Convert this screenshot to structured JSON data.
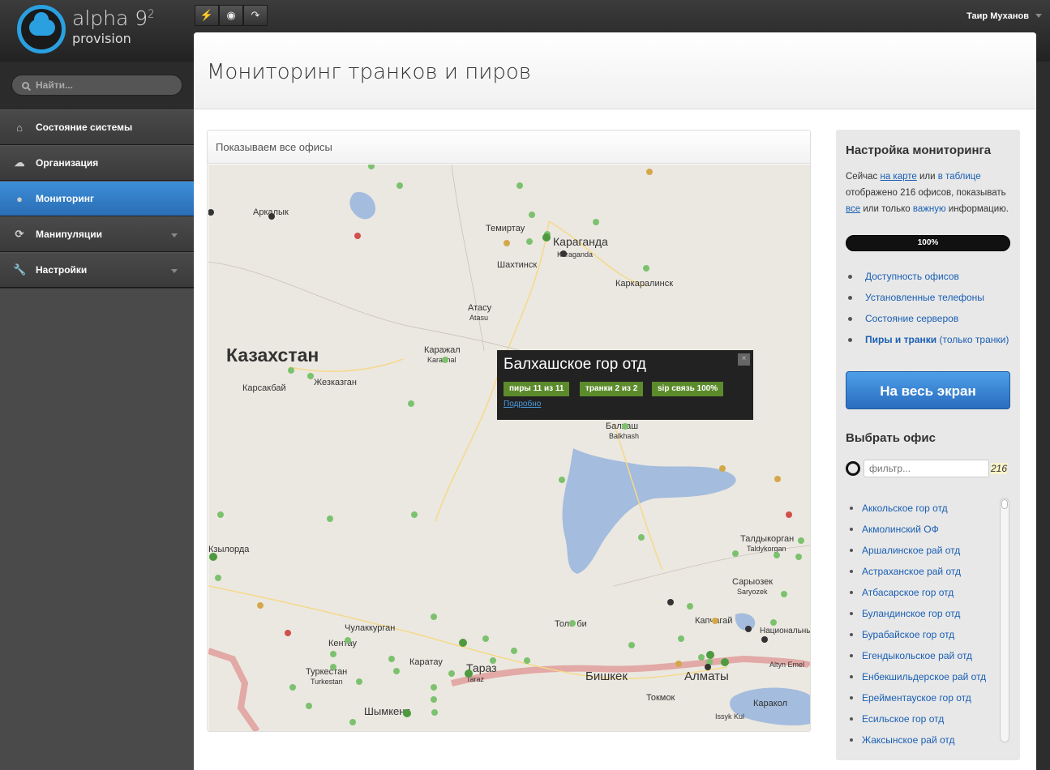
{
  "app": {
    "brand": "alpha 9",
    "brand_sup": "2",
    "brand_sub": "provision"
  },
  "toolbar": {
    "buttons": [
      {
        "icon": "lightning-icon",
        "glyph": "⚡"
      },
      {
        "icon": "eye-icon",
        "glyph": "◉"
      },
      {
        "icon": "redo-icon",
        "glyph": "↷"
      }
    ]
  },
  "user": {
    "name": "Таир Муханов"
  },
  "search": {
    "placeholder": "Найти..."
  },
  "nav": {
    "items": [
      {
        "label": "Состояние системы",
        "icon": "home-icon",
        "glyph": "⌂",
        "active": false
      },
      {
        "label": "Организация",
        "icon": "cloud-icon",
        "glyph": "☁",
        "active": false
      },
      {
        "label": "Мониторинг",
        "icon": "map-pin-icon",
        "glyph": "●",
        "active": true
      },
      {
        "label": "Манипуляции",
        "icon": "refresh-icon",
        "glyph": "⟳",
        "active": false
      },
      {
        "label": "Настройки",
        "icon": "wrench-icon",
        "glyph": "🔧",
        "active": false
      }
    ]
  },
  "page": {
    "title": "Мониторинг транков и пиров"
  },
  "map_panel": {
    "header": "Показываем все офисы"
  },
  "map": {
    "country_label": "Казахстан",
    "places": [
      "Аркалык",
      "Темиртау",
      "Караганда",
      "Karaganda",
      "Шахтинск",
      "Каркаралинск",
      "Атасу",
      "Atasu",
      "Каражал",
      "Karazhal",
      "Жезказган",
      "Карсакбай",
      "Балхаш",
      "Balkhash",
      "Кзылорда",
      "Талдыкорган",
      "Taldykorgan",
      "Сарыозек",
      "Saryozek",
      "Капчагай",
      "Национальный парк Алтын-Эмель",
      "Altyn Emel",
      "Чулаккурган",
      "Кентау",
      "Туркестан",
      "Turkestan",
      "Каратау",
      "Тараз",
      "Taraz",
      "Толе би",
      "Бишкек",
      "Токмок",
      "Алматы",
      "Шымкент",
      "Каракол",
      "Issyk Kul"
    ]
  },
  "popup": {
    "title": "Балхашское гор отд",
    "badges": [
      "пиры 11 из 11",
      "транки 2 из 2",
      "sip связь 100%"
    ],
    "link": "Подробно",
    "close": "×"
  },
  "settings": {
    "heading": "Настройка мониторинга",
    "text_prefix": "Сейчас",
    "link_map": "на карте",
    "text_or": "или",
    "link_table": "в таблице",
    "text_mid": "отображено 216 офисов, показывать",
    "link_all": "все",
    "text_or2": "или только",
    "link_important": "важную",
    "text_end": "информацию.",
    "progress": "100%",
    "progress_value": 1.0,
    "links": [
      "Доступность офисов",
      "Установленные телефоны",
      "Состояние серверов"
    ],
    "link_last_main": "Пиры и транки",
    "link_last_extra": "(только транки)",
    "fullscreen": "На весь экран"
  },
  "office_picker": {
    "heading": "Выбрать офис",
    "filter_placeholder": "фильтр...",
    "count": "216",
    "offices": [
      "Аккольское гор отд",
      "Акмолинский ОФ",
      "Аршалинское рай отд",
      "Астраханское рай отд",
      "Атбасарское гор отд",
      "Буландинское гор отд",
      "Бурабайское гор отд",
      "Егендыкольское рай отд",
      "Енбекшильдерское рай отд",
      "Ерейментауское гор отд",
      "Есильское гор отд",
      "Жаксынское рай отд"
    ]
  }
}
